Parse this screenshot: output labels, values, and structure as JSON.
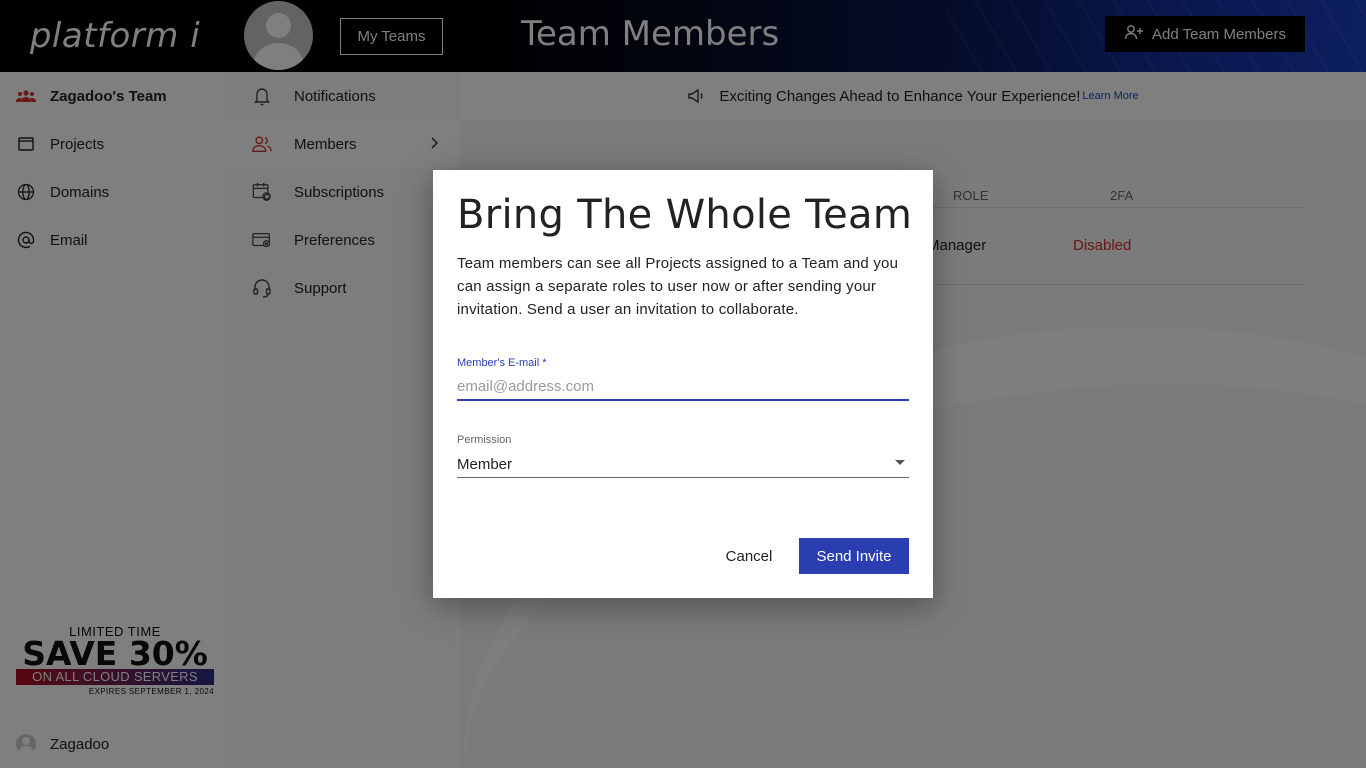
{
  "header": {
    "logo": "platform i",
    "my_teams_label": "My Teams",
    "page_title": "Team Members",
    "add_members_label": "Add Team Members"
  },
  "sidebar": {
    "team_name": "Zagadoo's Team",
    "items": [
      {
        "label": "Projects",
        "icon": "window-icon"
      },
      {
        "label": "Domains",
        "icon": "globe-icon"
      },
      {
        "label": "Email",
        "icon": "at-icon"
      }
    ],
    "promo": {
      "line1": "LIMITED TIME",
      "line2": "SAVE 30%",
      "line3": "ON ALL CLOUD SERVERS",
      "line4": "EXPIRES SEPTEMBER 1, 2024"
    },
    "user_name": "Zagadoo"
  },
  "subnav": {
    "items": [
      {
        "label": "Notifications",
        "icon": "bell-icon"
      },
      {
        "label": "Members",
        "icon": "users-icon"
      },
      {
        "label": "Subscriptions",
        "icon": "calendar-refresh-icon"
      },
      {
        "label": "Preferences",
        "icon": "card-gear-icon"
      },
      {
        "label": "Support",
        "icon": "headset-icon"
      }
    ]
  },
  "announcement": {
    "text": "Exciting Changes Ahead to Enhance Your Experience!",
    "link": "Learn More"
  },
  "table": {
    "headers": {
      "role": "ROLE",
      "tfa": "2FA"
    },
    "rows": [
      {
        "role": "Manager",
        "tfa": "Disabled"
      }
    ]
  },
  "modal": {
    "title": "Bring The Whole Team",
    "description": "Team members can see all Projects assigned to a Team and you can assign a separate roles to user now or after sending your invitation. Send a user an invitation to collaborate.",
    "email_label": "Member's E-mail *",
    "email_placeholder": "email@address.com",
    "email_value": "",
    "permission_label": "Permission",
    "permission_value": "Member",
    "cancel_label": "Cancel",
    "send_label": "Send Invite"
  },
  "colors": {
    "accent": "#2a3eb1",
    "danger": "#d32f2f",
    "team_icon": "#d03030"
  }
}
